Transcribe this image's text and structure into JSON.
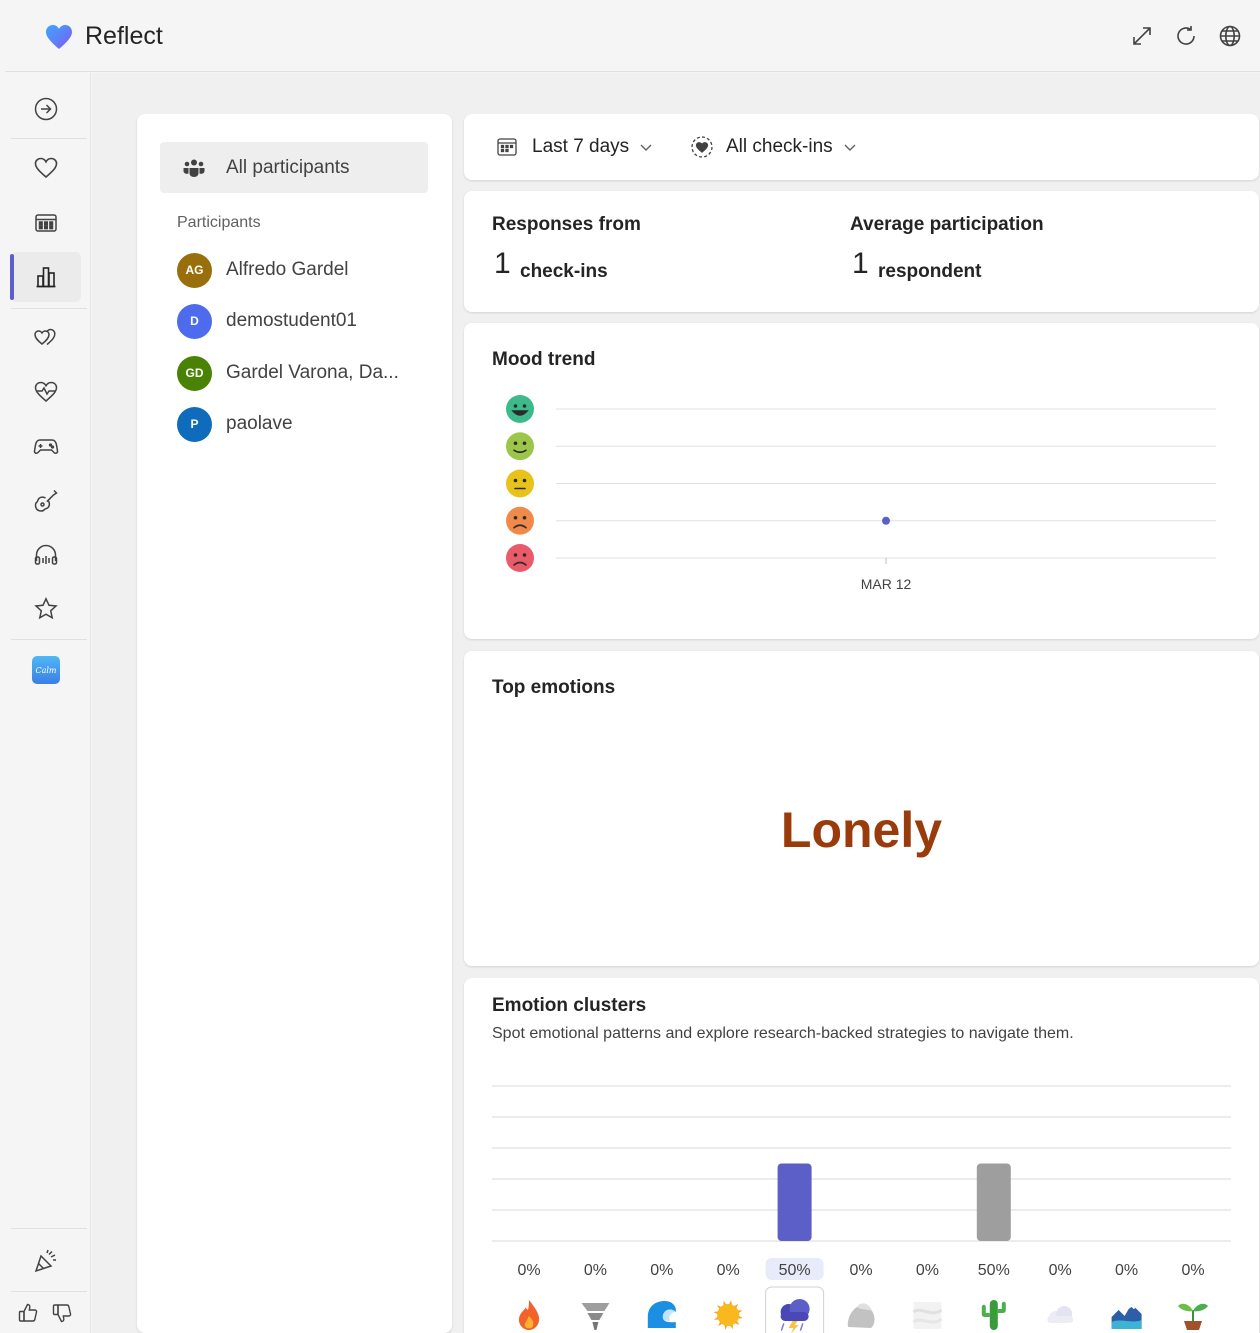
{
  "app": {
    "title": "Reflect"
  },
  "title_actions": [
    "expand-icon",
    "refresh-icon",
    "globe-icon"
  ],
  "rail": {
    "items": [
      {
        "name": "arrow-circle-icon",
        "active": false
      },
      {
        "name": "heart-icon",
        "active": false
      },
      {
        "name": "calendar-grid-icon",
        "active": false
      },
      {
        "name": "bar-chart-icon",
        "active": true
      },
      {
        "name": "hearts-icon",
        "active": false
      },
      {
        "name": "heartbeat-icon",
        "active": false
      },
      {
        "name": "game-controller-icon",
        "active": false
      },
      {
        "name": "guitar-icon",
        "active": false
      },
      {
        "name": "headphones-icon",
        "active": false
      },
      {
        "name": "star-icon",
        "active": false
      },
      {
        "name": "calm-app-icon",
        "active": false
      }
    ],
    "bottom": [
      "party-popper-icon",
      "thumbs-up-icon",
      "thumbs-down-icon"
    ],
    "calm_text": "Calm"
  },
  "participants": {
    "all_label": "All participants",
    "section_label": "Participants",
    "list": [
      {
        "initials": "AG",
        "name": "Alfredo Gardel",
        "color": "#986f0b"
      },
      {
        "initials": "D",
        "name": "demostudent01",
        "color": "#4f6bed"
      },
      {
        "initials": "GD",
        "name": "Gardel Varona, Da...",
        "color": "#498205"
      },
      {
        "initials": "P",
        "name": "paolave",
        "color": "#0f6cbd"
      }
    ]
  },
  "filters": {
    "date_range": "Last 7 days",
    "checkins": "All check-ins"
  },
  "stats": {
    "responses_label": "Responses from",
    "responses_value": "1",
    "responses_unit": "check-ins",
    "participation_label": "Average participation",
    "participation_value": "1",
    "participation_unit": "respondent"
  },
  "mood_trend": {
    "title": "Mood trend",
    "levels": [
      {
        "name": "very-happy-face-icon",
        "color": "#3dba8c"
      },
      {
        "name": "happy-face-icon",
        "color": "#9cc64a"
      },
      {
        "name": "neutral-face-icon",
        "color": "#e6c21b"
      },
      {
        "name": "sad-face-icon",
        "color": "#f08a4b"
      },
      {
        "name": "angry-face-icon",
        "color": "#ea5a6a"
      }
    ]
  },
  "top_emotions": {
    "title": "Top emotions",
    "emotion": "Lonely"
  },
  "clusters": {
    "title": "Emotion clusters",
    "subtitle": "Spot emotional patterns and explore research-backed strategies to navigate them."
  },
  "chart_data": [
    {
      "type": "scatter",
      "title": "Mood trend",
      "x": [
        "MAR 12"
      ],
      "y": [
        2
      ],
      "y_levels": [
        "angry",
        "sad",
        "neutral",
        "happy",
        "very happy"
      ],
      "ylim": [
        1,
        5
      ],
      "grid": true,
      "point_color": "#5b5fc7"
    },
    {
      "type": "bar",
      "title": "Emotion clusters",
      "categories": [
        "fire-icon",
        "tornado-icon",
        "wave-icon",
        "sun-icon",
        "storm-cloud-icon",
        "rock-icon",
        "fog-icon",
        "cactus-icon",
        "cloud-icon",
        "landscape-icon",
        "sprout-icon"
      ],
      "values": [
        0,
        0,
        0,
        0,
        50,
        0,
        0,
        50,
        0,
        0,
        0
      ],
      "labels": [
        "0%",
        "0%",
        "0%",
        "0%",
        "50%",
        "0%",
        "0%",
        "50%",
        "0%",
        "0%",
        "0%"
      ],
      "selected_index": 4,
      "bar_colors": [
        "#5b5fc7",
        "#5b5fc7",
        "#5b5fc7",
        "#5b5fc7",
        "#5b5fc7",
        "#5b5fc7",
        "#5b5fc7",
        "#9e9e9e",
        "#5b5fc7",
        "#5b5fc7",
        "#5b5fc7"
      ],
      "ylim": [
        0,
        100
      ],
      "grid": true
    }
  ]
}
